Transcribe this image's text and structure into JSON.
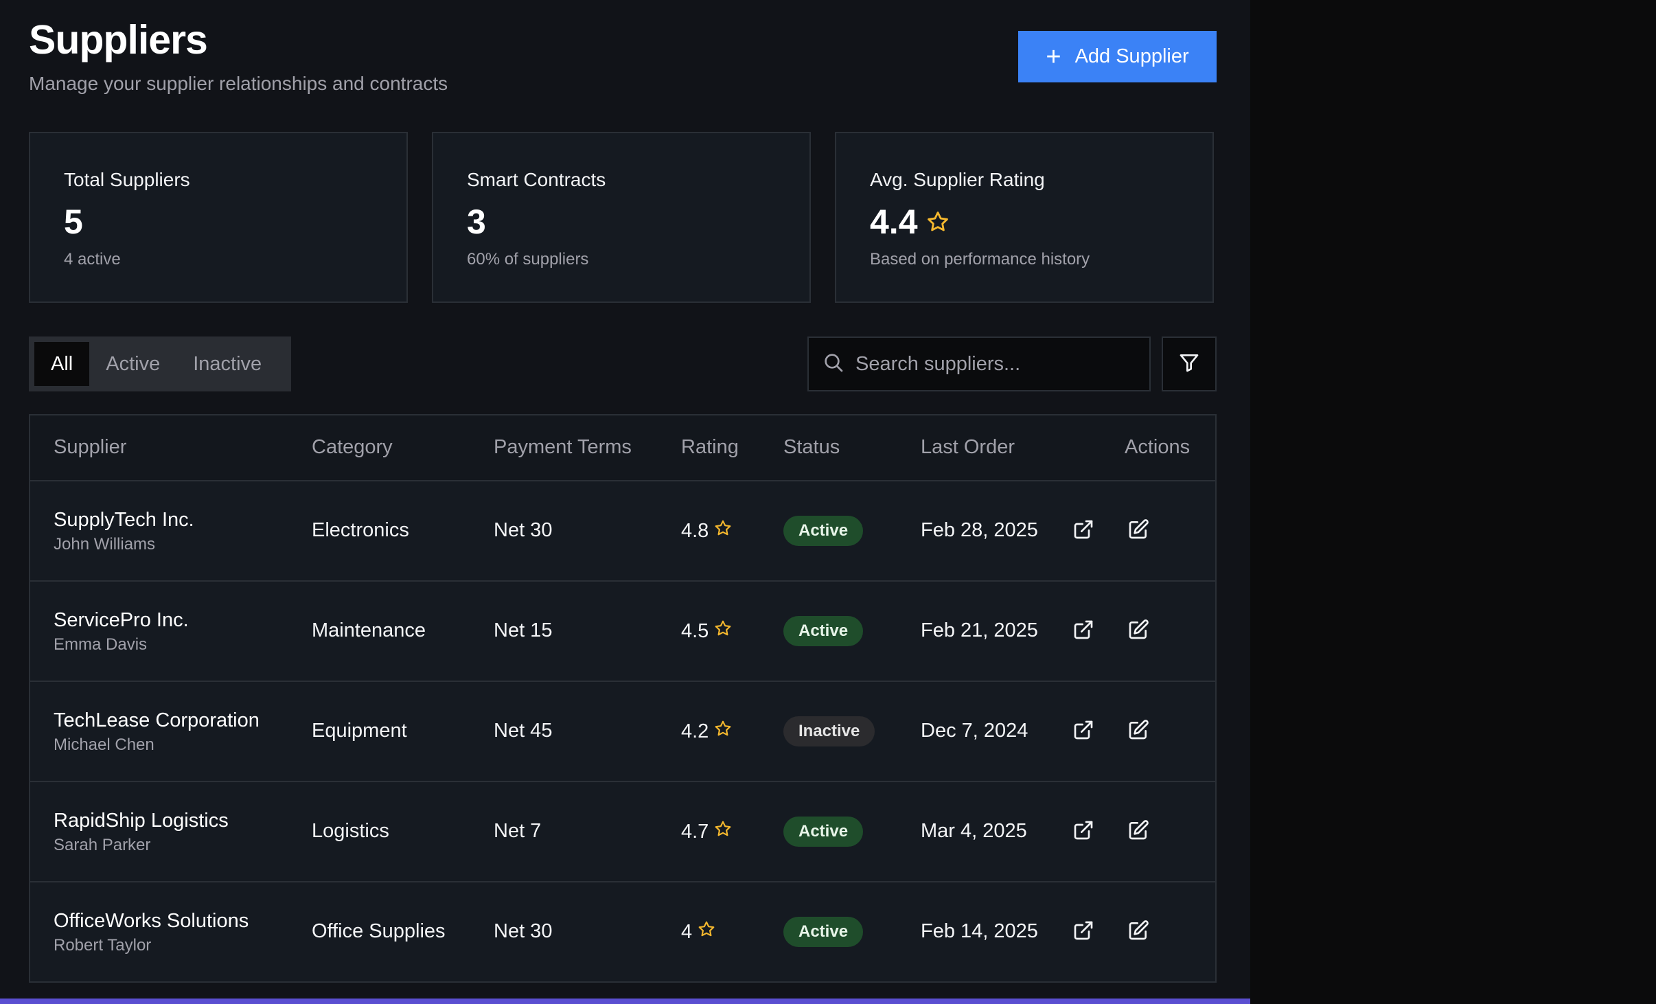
{
  "header": {
    "title": "Suppliers",
    "subtitle": "Manage your supplier relationships and contracts",
    "add_button_label": "Add Supplier"
  },
  "stats": [
    {
      "label": "Total Suppliers",
      "value": "5",
      "sub": "4 active"
    },
    {
      "label": "Smart Contracts",
      "value": "3",
      "sub": "60% of suppliers"
    },
    {
      "label": "Avg. Supplier Rating",
      "value": "4.4",
      "sub": "Based on performance history",
      "icon": "star-icon"
    }
  ],
  "filters": {
    "tabs": [
      "All",
      "Active",
      "Inactive"
    ],
    "selected_tab": "All",
    "search_placeholder": "Search suppliers..."
  },
  "table": {
    "columns": [
      "Supplier",
      "Category",
      "Payment Terms",
      "Rating",
      "Status",
      "Last Order",
      "Actions"
    ],
    "rows": [
      {
        "name": "SupplyTech Inc.",
        "contact": "John Williams",
        "category": "Electronics",
        "terms": "Net 30",
        "rating": "4.8",
        "status": "Active",
        "last_order": "Feb 28, 2025"
      },
      {
        "name": "ServicePro Inc.",
        "contact": "Emma Davis",
        "category": "Maintenance",
        "terms": "Net 15",
        "rating": "4.5",
        "status": "Active",
        "last_order": "Feb 21, 2025"
      },
      {
        "name": "TechLease Corporation",
        "contact": "Michael Chen",
        "category": "Equipment",
        "terms": "Net 45",
        "rating": "4.2",
        "status": "Inactive",
        "last_order": "Dec 7, 2024"
      },
      {
        "name": "RapidShip Logistics",
        "contact": "Sarah Parker",
        "category": "Logistics",
        "terms": "Net 7",
        "rating": "4.7",
        "status": "Active",
        "last_order": "Mar 4, 2025"
      },
      {
        "name": "OfficeWorks Solutions",
        "contact": "Robert Taylor",
        "category": "Office Supplies",
        "terms": "Net 30",
        "rating": "4",
        "status": "Active",
        "last_order": "Feb 14, 2025"
      }
    ]
  },
  "colors": {
    "accent": "#3b82f6",
    "star": "#f5b82e",
    "active_badge": "#1f4d2b",
    "inactive_badge": "#2b2b2e"
  }
}
